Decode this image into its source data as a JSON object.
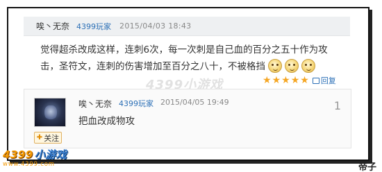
{
  "post": {
    "username": "唉丶无奈",
    "level": "4399玩家",
    "time": "2015/04/03 18:43",
    "content": "觉得超杀改成这样，连刺6次，每一次刺是自己血的百分之五十作为攻击，圣符文，连刺的伤害增加至百分之八十，不被格挡",
    "emoji_count": 3,
    "rating_stars": 5,
    "reply_label": "回复"
  },
  "watermark": "4399小游戏",
  "reply": {
    "username": "唉丶无奈",
    "level": "4399玩家",
    "time": "2015/04/05 19:49",
    "content": "把血改成物攻",
    "floor": "1",
    "follow_label": "关注"
  },
  "brand": {
    "logo_num": "4399",
    "logo_cn": "小游戏",
    "url": "www.4399.com"
  },
  "caption": "帝子",
  "colors": {
    "link": "#2b6fb6",
    "star": "#f5a623",
    "brand_orange": "#f39800",
    "brand_blue": "#3a7fd0"
  }
}
